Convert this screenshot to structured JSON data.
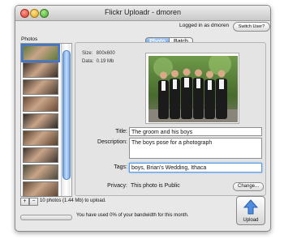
{
  "window": {
    "title": "Flickr Uploadr - dmoren",
    "login_text": "Logged in as dmoren",
    "switch_user_label": "Switch User?"
  },
  "sidebar": {
    "photos_label": "Photos",
    "thumbnail_count_visible": 9
  },
  "tabs": [
    {
      "label": "Photo",
      "selected": true
    },
    {
      "label": "Batch",
      "selected": false
    }
  ],
  "photo_info": {
    "size_label": "Size:",
    "size_value": "800x600",
    "data_label": "Data:",
    "data_value": "0.19 Mb"
  },
  "form": {
    "title_label": "Title:",
    "title_value": "The groom and his boys",
    "description_label": "Description:",
    "description_value": "The boys pose for a photograph",
    "tags_label": "Tags:",
    "tags_value": "boys, Brian's Wedding, Ithaca",
    "privacy_label": "Privacy:",
    "privacy_value": "This photo is Public",
    "change_label": "Change..."
  },
  "footer": {
    "add_label": "+",
    "remove_label": "−",
    "upload_count_text": "10 photos (1.44 Mb) to upload.",
    "bandwidth_text": "You have used 0% of your bandwidth for this month.",
    "bandwidth_used_percent": 0,
    "upload_label": "Upload"
  },
  "colors": {
    "accent": "#4e8ee0",
    "focus_ring": "#5a9bea"
  }
}
